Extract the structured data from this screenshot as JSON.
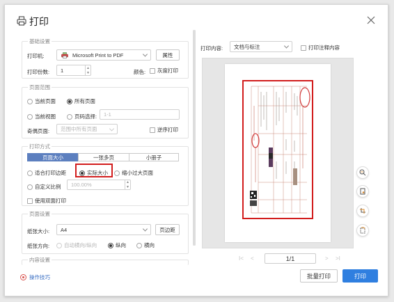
{
  "dialog": {
    "title": "打印",
    "close_icon": "close-icon"
  },
  "basic": {
    "legend": "基础设置",
    "printer_label": "打印机:",
    "printer_value": "Microsoft Print to PDF",
    "properties_button": "属性",
    "copies_label": "打印份数:",
    "copies_value": "1",
    "color_label": "颜色:",
    "grayscale_label": "灰度打印"
  },
  "page_range": {
    "legend": "页面范围",
    "current_page": "当前页面",
    "all_pages": "所有页面",
    "current_view": "当前视图",
    "page_select": "页码选择:",
    "page_select_placeholder": "1-1",
    "odd_even_label": "奇偶页面:",
    "odd_even_value": "范围中所有页面",
    "reverse_order": "逆序打印"
  },
  "print_mode": {
    "legend": "打印方式",
    "tabs": [
      "页面大小",
      "一张多页",
      "小册子"
    ],
    "fit_margins": "适合打印边距",
    "actual_size": "实际大小",
    "shrink_large": "缩小过大页面",
    "custom_scale": "自定义比例",
    "scale_value": "100.00%",
    "duplex": "使用双面打印"
  },
  "page_setup": {
    "legend": "页面设置",
    "paper_size_label": "纸张大小:",
    "paper_size_value": "A4",
    "margins_button": "页边距",
    "orientation_label": "纸张方向:",
    "auto_orientation": "自动横向/纵向",
    "portrait": "纵向",
    "landscape": "横向"
  },
  "content_settings": {
    "legend": "内容设置"
  },
  "right": {
    "content_label": "打印内容:",
    "content_value": "文档与标注",
    "print_annotations": "打印注释内容"
  },
  "pager": {
    "first": "I<",
    "prev": "<",
    "value": "1/1",
    "next": ">",
    "last": ">I"
  },
  "footer": {
    "tips": "操作技巧",
    "batch_print": "批量打印",
    "print": "打印"
  },
  "colors": {
    "accent": "#2f7fe0",
    "highlight": "#d21c1c",
    "seg_selected": "#5c7fbf"
  }
}
